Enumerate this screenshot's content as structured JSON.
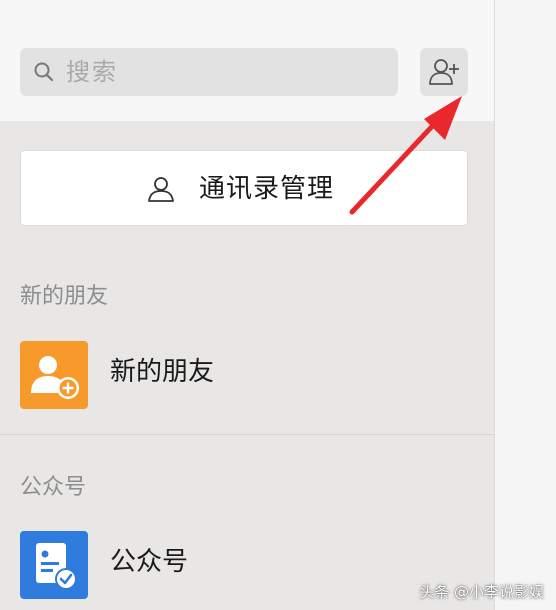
{
  "search": {
    "placeholder": "搜索",
    "icon": "search-icon"
  },
  "add_friend_button": {
    "icon": "add-contact-icon"
  },
  "contacts_management": {
    "label": "通讯录管理",
    "icon": "person-icon"
  },
  "sections": [
    {
      "header": "新的朋友",
      "item_label": "新的朋友",
      "icon": "new-friend-icon",
      "icon_color": "#f79a2b"
    },
    {
      "header": "公众号",
      "item_label": "公众号",
      "icon": "official-account-icon",
      "icon_color": "#2f7bde"
    }
  ],
  "annotation": {
    "arrow_color": "#e8282b"
  },
  "watermark": {
    "text": "头条 @小李说影娱"
  }
}
